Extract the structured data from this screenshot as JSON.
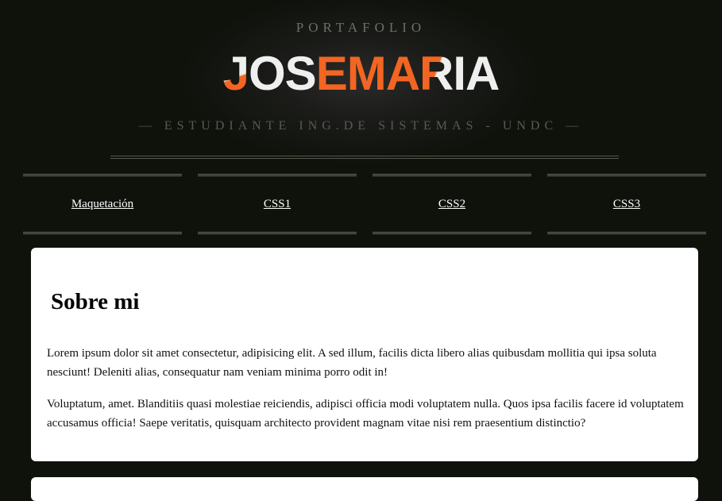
{
  "header": {
    "kicker": "PORTAFOLIO",
    "logo_parts": [
      "J",
      "OS",
      "E",
      "MA",
      "R",
      "IA"
    ],
    "tagline": "— ESTUDIANTE ING.DE SISTEMAS - UNDC —"
  },
  "nav": {
    "items": [
      {
        "label": "Maquetación"
      },
      {
        "label": "CSS1"
      },
      {
        "label": "CSS2"
      },
      {
        "label": "CSS3"
      }
    ]
  },
  "about": {
    "title": "Sobre mi",
    "paragraphs": [
      "Lorem ipsum dolor sit amet consectetur, adipisicing elit. A sed illum, facilis dicta libero alias quibusdam mollitia qui ipsa soluta nesciunt! Deleniti alias, consequatur nam veniam minima porro odit in!",
      "Voluptatum, amet. Blanditiis quasi molestiae reiciendis, adipisci officia modi voluptatem nulla. Quos ipsa facilis facere id voluptatem accusamus officia! Saepe veritatis, quisquam architecto provident magnam vitae nisi rem praesentium distinctio?"
    ]
  },
  "colors": {
    "background": "#0e120b",
    "accent": "#f26522",
    "logo_white": "#efefef",
    "card": "#ffffff"
  }
}
